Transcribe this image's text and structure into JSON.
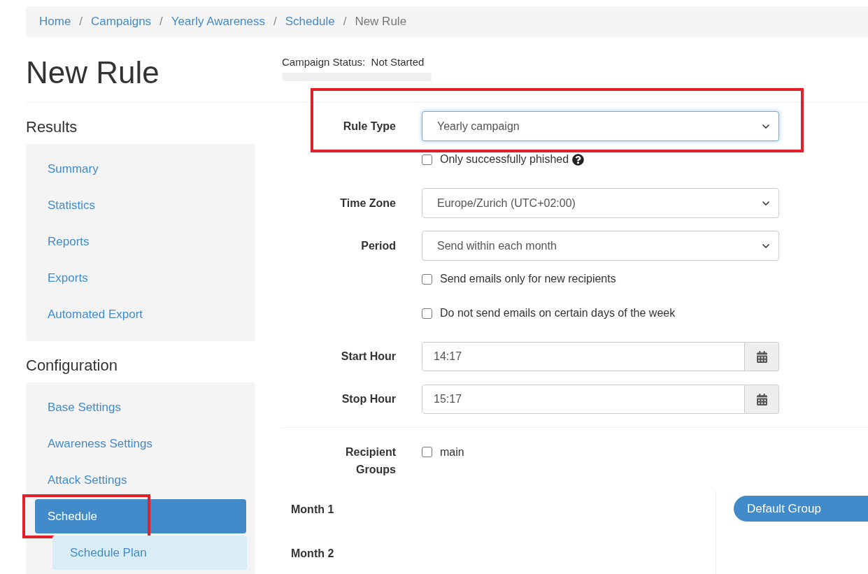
{
  "breadcrumb": [
    {
      "label": "Home",
      "current": false
    },
    {
      "separator": "/",
      "label": "Campaigns",
      "current": false
    },
    {
      "separator": "/",
      "label": "Yearly Awareness",
      "current": false
    },
    {
      "separator": "/",
      "label": "Schedule",
      "current": false
    },
    {
      "separator": "/",
      "label": "New Rule",
      "current": true
    }
  ],
  "title": "New Rule",
  "campaign_status": {
    "label": "Campaign Status:",
    "value": "Not Started"
  },
  "sidebar": [
    {
      "heading": "Results",
      "items": [
        {
          "label": "Summary",
          "selected": false,
          "highlighted": false
        },
        {
          "label": "Statistics",
          "selected": false,
          "highlighted": false
        },
        {
          "label": "Reports",
          "selected": false,
          "highlighted": false
        },
        {
          "label": "Exports",
          "selected": false,
          "highlighted": false
        },
        {
          "label": "Automated Export",
          "selected": false,
          "highlighted": false
        }
      ]
    },
    {
      "heading": "Configuration",
      "items": [
        {
          "label": "Base Settings",
          "selected": false,
          "highlighted": false
        },
        {
          "label": "Awareness Settings",
          "selected": false,
          "highlighted": false
        },
        {
          "label": "Attack Settings",
          "selected": false,
          "highlighted": false
        },
        {
          "label": "Schedule",
          "selected": true,
          "highlighted": true,
          "children": [
            {
              "label": "Schedule Plan",
              "selected": false,
              "highlighted": false
            }
          ]
        }
      ]
    }
  ],
  "fields": [
    {
      "kind": "select",
      "label": "Rule Type",
      "value": "Yearly campaign",
      "highlighted": true
    },
    {
      "kind": "checkbox",
      "label": "Only successfully phished",
      "checked": false,
      "help": true
    },
    {
      "kind": "select",
      "label": "Time Zone",
      "value": "Europe/Zurich (UTC+02:00)",
      "highlighted": false
    },
    {
      "kind": "select",
      "label": "Period",
      "value": "Send within each month",
      "highlighted": false
    },
    {
      "kind": "checkbox",
      "label": "Send emails only for new recipients",
      "checked": false,
      "help": false
    },
    {
      "kind": "checkbox",
      "label": "Do not send emails on certain days of the week",
      "checked": false,
      "help": false
    },
    {
      "kind": "time",
      "label": "Start Hour",
      "value": "14:17"
    },
    {
      "kind": "time",
      "label": "Stop Hour",
      "value": "15:17"
    }
  ],
  "recipient_groups": {
    "label": "Recipient Groups",
    "options": [
      {
        "label": "main",
        "checked": false
      }
    ]
  },
  "months": [
    {
      "label": "Month 1",
      "groups": [
        "Default Group"
      ]
    },
    {
      "label": "Month 2"
    }
  ]
}
